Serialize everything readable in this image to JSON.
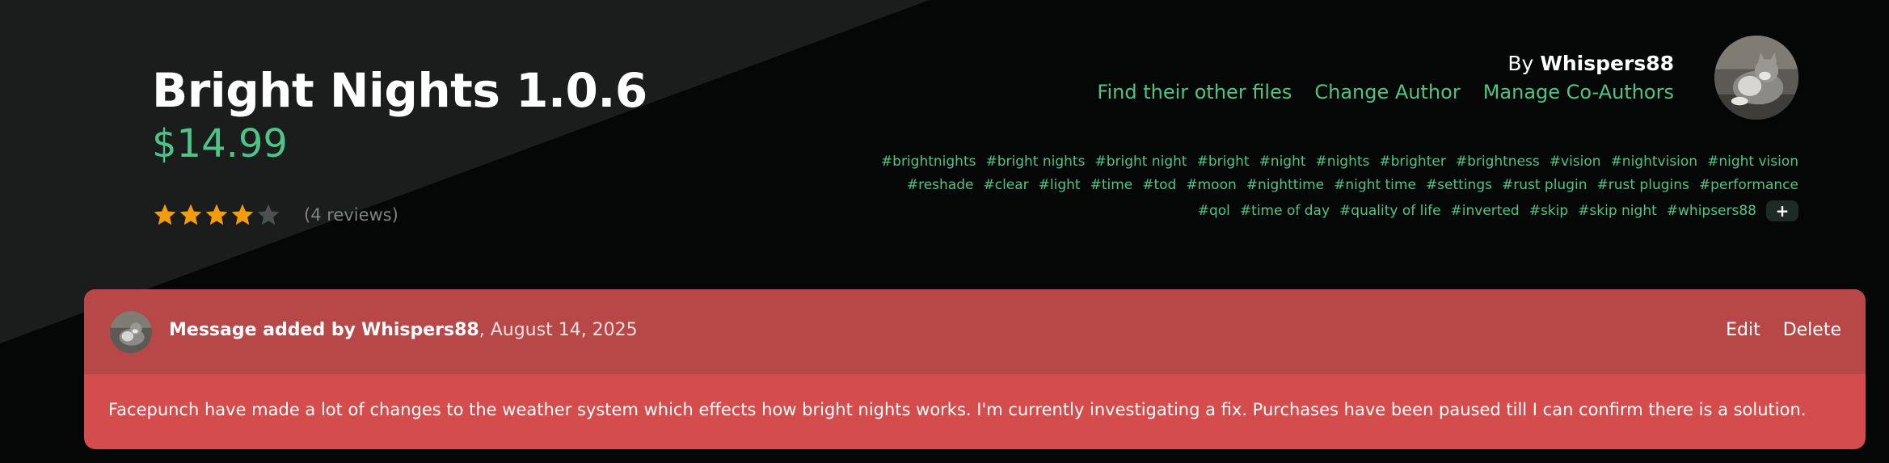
{
  "product": {
    "title": "Bright Nights 1.0.6",
    "price": "$14.99",
    "rating": {
      "value": 4,
      "max": 5,
      "reviews_label": "(4 reviews)"
    }
  },
  "author": {
    "by_prefix": "By",
    "name": "Whispers88",
    "links": [
      "Find their other files",
      "Change Author",
      "Manage Co-Authors"
    ]
  },
  "tags": {
    "rows": [
      [
        "#brightnights",
        "#bright nights",
        "#bright night",
        "#bright",
        "#night",
        "#nights",
        "#brighter",
        "#brightness",
        "#vision",
        "#nightvision",
        "#night vision"
      ],
      [
        "#reshade",
        "#clear",
        "#light",
        "#time",
        "#tod",
        "#moon",
        "#nighttime",
        "#night time",
        "#settings",
        "#rust plugin",
        "#rust plugins",
        "#performance"
      ],
      [
        "#qol",
        "#time of day",
        "#quality of life",
        "#inverted",
        "#skip",
        "#skip night",
        "#whipsers88"
      ]
    ],
    "more_label": "+"
  },
  "message": {
    "prefix": "Message added by",
    "author": "Whispers88",
    "date": ", August 14, 2025",
    "edit_label": "Edit",
    "delete_label": "Delete",
    "body": "Facepunch have made a lot of changes to the weather system which effects how bright nights works. I'm currently investigating a fix. Purchases have been paused till I can confirm there is a solution."
  },
  "colors": {
    "accent": "#4ec488",
    "star_filled": "#f39c12",
    "star_empty": "#4a4f4f",
    "message_bg": "#d54c4c",
    "message_head_bg": "#b84848"
  },
  "icons": {
    "star": "star-icon",
    "avatar": "cat-avatar-image"
  }
}
